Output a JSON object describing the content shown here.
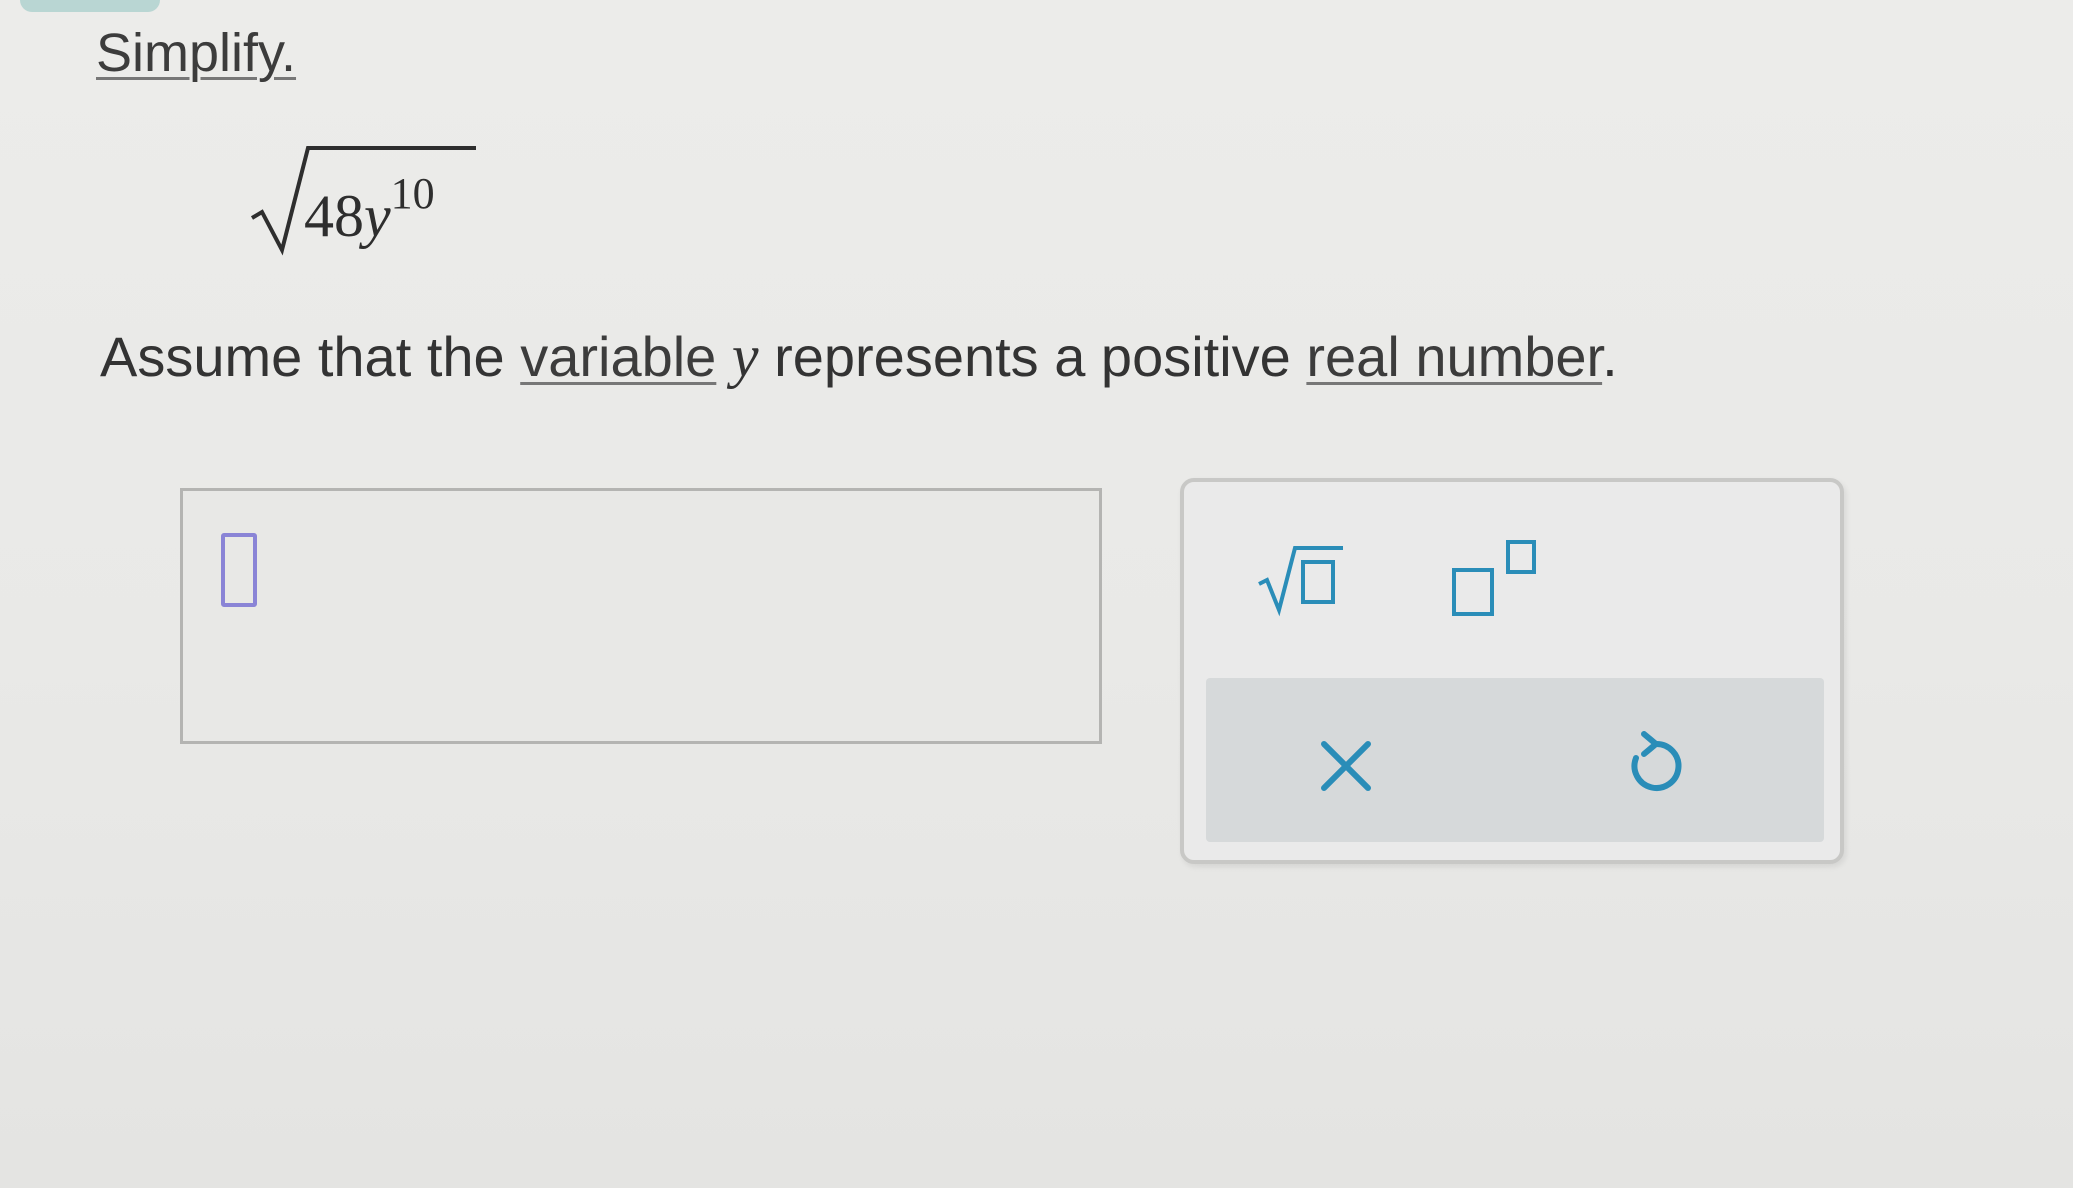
{
  "prompt": {
    "instruction": "Simplify."
  },
  "expression": {
    "coefficient": "48",
    "variable": "y",
    "exponent": "10"
  },
  "assumption": {
    "text_before": "Assume that the ",
    "link_variable": "variable",
    "variable": "y",
    "text_middle": " represents a positive ",
    "link_real_number": "real number",
    "text_after": "."
  },
  "answer": {
    "value": ""
  },
  "keypad": {
    "keys": [
      "square-root",
      "exponent",
      "clear",
      "undo"
    ],
    "clear_symbol": "×",
    "icon_color": "#2a8db8"
  }
}
